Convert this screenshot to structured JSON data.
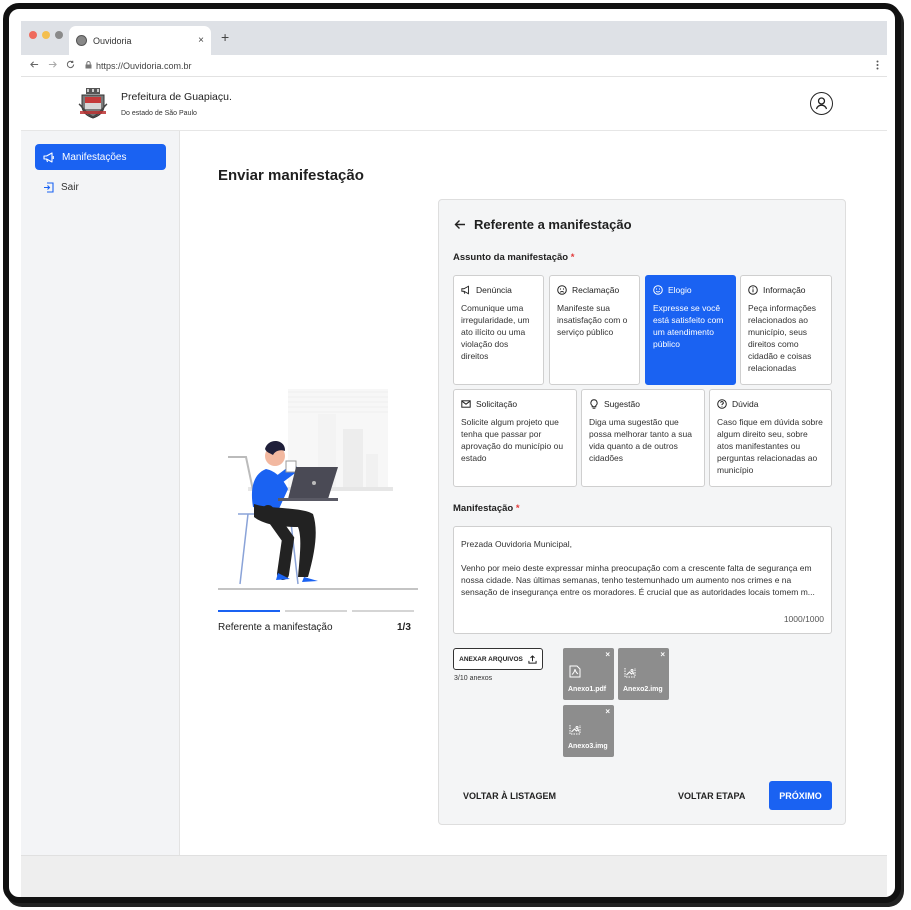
{
  "browser": {
    "tab_title": "Ouvidoria",
    "tab_close": "×",
    "new_tab": "+",
    "url": "https://Ouvidoria.com.br",
    "dot_colors": [
      "#ef6b5e",
      "#f4bf4f",
      "#8a8a8a"
    ]
  },
  "header": {
    "org_name": "Prefeitura de Guapiaçu.",
    "org_sub": "Do estado de São Paulo"
  },
  "sidebar": {
    "items": [
      {
        "label": "Manifestações",
        "icon": "megaphone-icon",
        "active": true
      },
      {
        "label": "Sair",
        "icon": "logout-icon",
        "active": false
      }
    ]
  },
  "main": {
    "page_title": "Enviar manifestação",
    "progress": {
      "step_label": "Referente a manifestação",
      "step_count": "1/3",
      "current": 1,
      "total": 3
    }
  },
  "form": {
    "title": "Referente a manifestação",
    "subject_label": "Assunto da manifestação",
    "required_mark": "*",
    "options": [
      {
        "title": "Denúncia",
        "icon": "megaphone-icon",
        "desc": "Comunique uma irregularidade, um ato ilícito ou uma violação dos direitos",
        "selected": false
      },
      {
        "title": "Reclamação",
        "icon": "sad-face-icon",
        "desc": "Manifeste sua insatisfação com o serviço público",
        "selected": false
      },
      {
        "title": "Elogio",
        "icon": "smile-face-icon",
        "desc": "Expresse se você está satisfeito com um atendimento público",
        "selected": true
      },
      {
        "title": "Informação",
        "icon": "info-icon",
        "desc": "Peça informações relacionados ao município, seus direitos como cidadão e coisas relacionadas",
        "selected": false
      },
      {
        "title": "Solicitação",
        "icon": "mail-icon",
        "desc": "Solicite algum projeto que tenha que passar por aprovação do município ou estado",
        "selected": false
      },
      {
        "title": "Sugestão",
        "icon": "lightbulb-icon",
        "desc": "Diga uma sugestão que possa melhorar tanto a sua vida quanto a de outros cidadões",
        "selected": false
      },
      {
        "title": "Dúvida",
        "icon": "question-icon",
        "desc": "Caso fique em dúvida sobre algum direito seu, sobre atos manifestantes ou perguntas relacionadas ao município",
        "selected": false
      }
    ],
    "manifest_label": "Manifestação",
    "manifest_p1": "Prezada Ouvidoria Municipal,",
    "manifest_p2": "Venho por meio deste expressar minha preocupação com a crescente falta de segurança em nossa cidade. Nas últimas semanas, tenho testemunhado um aumento nos crimes e na sensação de insegurança entre os moradores. É crucial que as autoridades locais tomem m...",
    "counter": "1000/1000",
    "attach_label": "ANEXAR ARQUIVOS",
    "attach_count": "3/10 anexos",
    "files": [
      {
        "name": "Anexo1.pdf",
        "icon": "pdf-file-icon"
      },
      {
        "name": "Anexo2.img",
        "icon": "image-file-icon"
      },
      {
        "name": "Anexo3.img",
        "icon": "image-file-icon"
      }
    ],
    "file_remove": "×",
    "back_list": "VOLTAR À LISTAGEM",
    "back_step": "VOLTAR ETAPA",
    "next": "PRÓXIMO"
  }
}
